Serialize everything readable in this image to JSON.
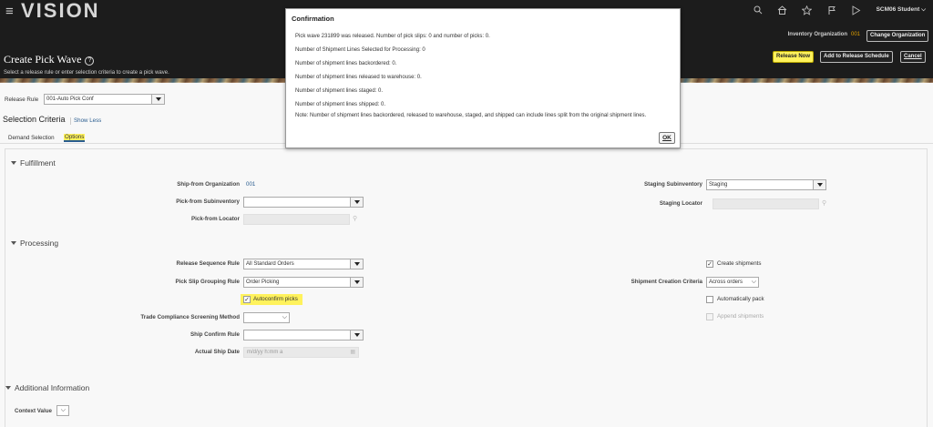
{
  "header": {
    "logo": "VISION",
    "user": "SCM06 Student",
    "icons": [
      "search-icon",
      "home-icon",
      "star-icon",
      "flag-icon",
      "notifications-icon"
    ],
    "inventory_org_label": "Inventory Organization",
    "inventory_org_value": "001",
    "change_org_button": "Change Organization"
  },
  "page": {
    "title": "Create Pick Wave",
    "subtitle": "Select a release rule or enter selection criteria to create a pick wave.",
    "buttons": {
      "release_now": "Release Now",
      "add_to_schedule": "Add to Release Schedule",
      "cancel": "Cancel"
    }
  },
  "release_rule": {
    "label": "Release Rule",
    "value": "001-Auto Pick Conf"
  },
  "selection_criteria": {
    "title": "Selection Criteria",
    "show_less": "Show Less",
    "tabs": [
      "Demand Selection",
      "Options"
    ],
    "active_tab": "Options"
  },
  "fulfillment": {
    "title": "Fulfillment",
    "ship_from_org_label": "Ship-from Organization",
    "ship_from_org_value": "001",
    "pick_from_subinv_label": "Pick-from Subinventory",
    "pick_from_subinv_value": "",
    "pick_from_locator_label": "Pick-from Locator",
    "staging_subinv_label": "Staging Subinventory",
    "staging_subinv_value": "Staging",
    "staging_locator_label": "Staging Locator"
  },
  "processing": {
    "title": "Processing",
    "release_seq_label": "Release Sequence Rule",
    "release_seq_value": "All Standard Orders",
    "pick_slip_label": "Pick Slip Grouping Rule",
    "pick_slip_value": "Order Picking",
    "autoconfirm_label": "Autoconfirm picks",
    "autoconfirm_checked": true,
    "trade_compliance_label": "Trade Compliance Screening Method",
    "trade_compliance_value": "",
    "ship_confirm_label": "Ship Confirm Rule",
    "ship_confirm_value": "",
    "actual_ship_date_label": "Actual Ship Date",
    "actual_ship_date_placeholder": "m/d/yy h:mm a",
    "create_shipments_label": "Create shipments",
    "create_shipments_checked": true,
    "shipment_creation_label": "Shipment Creation Criteria",
    "shipment_creation_value": "Across orders",
    "auto_pack_label": "Automatically pack",
    "auto_pack_checked": false,
    "append_shipments_label": "Append shipments",
    "append_shipments_checked": false
  },
  "additional_info": {
    "title": "Additional Information",
    "context_value_label": "Context Value"
  },
  "modal": {
    "title": "Confirmation",
    "messages": [
      "Pick wave 231899 was released. Number of pick slips: 0 and number of picks: 0.",
      "Number of Shipment Lines Selected for Processing: 0",
      "Number of shipment lines backordered: 0.",
      "Number of shipment lines released to warehouse: 0.",
      "Number of shipment lines staged: 0.",
      "Number of shipment lines shipped: 0."
    ],
    "note": "Note: Number of shipment lines backordered, released to warehouse, staged, and shipped can include lines split from the original shipment lines.",
    "ok_label": "OK"
  },
  "colors": {
    "header_bg": "#1c1c1c",
    "highlight": "#fff25c",
    "link": "#2a5d8f",
    "org_value": "#e0a000"
  }
}
